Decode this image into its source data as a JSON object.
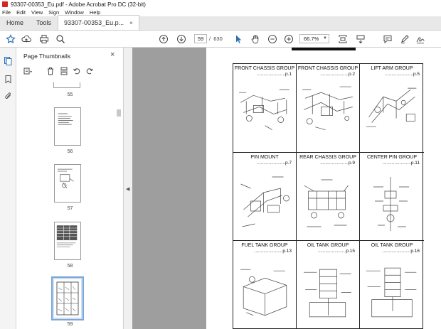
{
  "window": {
    "title": "93307-00353_Eu.pdf - Adobe Acrobat Pro DC (32-bit)"
  },
  "menu": [
    "File",
    "Edit",
    "View",
    "Sign",
    "Window",
    "Help"
  ],
  "tabs": {
    "home": "Home",
    "tools": "Tools",
    "document": "93307-00353_Eu.p...",
    "close": "×"
  },
  "toolbar": {
    "current_page": "59",
    "page_separator": "/",
    "total_pages": "630",
    "zoom": "66.7%",
    "icons": [
      "star-icon",
      "upload-icon",
      "print-icon",
      "zoom-search-icon",
      "page-up-icon",
      "page-down-icon",
      "select-arrow-icon",
      "hand-icon",
      "zoom-out-icon",
      "zoom-in-icon",
      "fit-page-icon",
      "scroll-mode-icon",
      "comment-icon",
      "highlight-icon",
      "sign-icon"
    ]
  },
  "sidebar": {
    "title": "Page Thumbnails",
    "close": "×",
    "thumbnails": [
      {
        "label": "55"
      },
      {
        "label": "56"
      },
      {
        "label": "57"
      },
      {
        "label": "58"
      },
      {
        "label": "59",
        "selected": true
      }
    ]
  },
  "document": {
    "cells": [
      {
        "title": "FRONT CHASSIS GROUP",
        "page": "......................p.1"
      },
      {
        "title": "FRONT CHASSIS GROUP",
        "page": "......................p.2"
      },
      {
        "title": "LIFT ARM GROUP",
        "page": "......................p.5"
      },
      {
        "title": "PIN MOUNT",
        "page": "......................p.7"
      },
      {
        "title": "REAR CHASSIS GROUP",
        "page": "......................p.9"
      },
      {
        "title": "CENTER PIN GROUP",
        "page": "......................p.11"
      },
      {
        "title": "FUEL TANK GROUP",
        "page": "......................p.13"
      },
      {
        "title": "OIL TANK GROUP",
        "page": "......................p.15"
      },
      {
        "title": "OIL TANK GROUP",
        "page": "......................p.16"
      }
    ]
  },
  "colors": {
    "doc_background": "#9e9e9e",
    "selection": "#7aa7d6",
    "app_red": "#d7261c"
  }
}
